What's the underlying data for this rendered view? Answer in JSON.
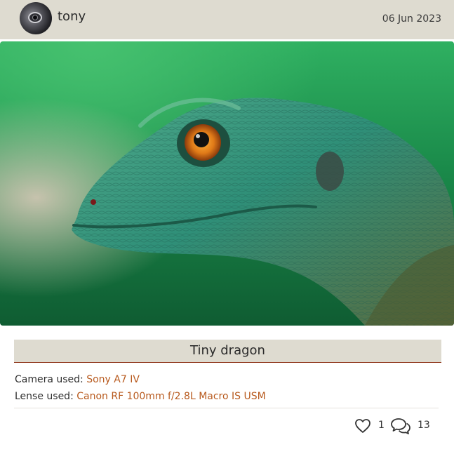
{
  "post": {
    "author": "tony",
    "date": "06 Jun 2023",
    "title": "Tiny dragon",
    "camera_label": "Camera used:",
    "camera_value": "Sony A7 IV",
    "lens_label": "Lense used:",
    "lens_value": "Canon RF 100mm f/2.8L Macro IS USM"
  },
  "actions": {
    "likes": "1",
    "comments": "13"
  },
  "icons": {
    "like": "heart-icon",
    "comments": "comments-icon",
    "avatar": "camera-lens-avatar"
  },
  "colors": {
    "header_bg": "#dedbd0",
    "accent": "#b85a1e",
    "title_underline": "#8b2d12"
  }
}
